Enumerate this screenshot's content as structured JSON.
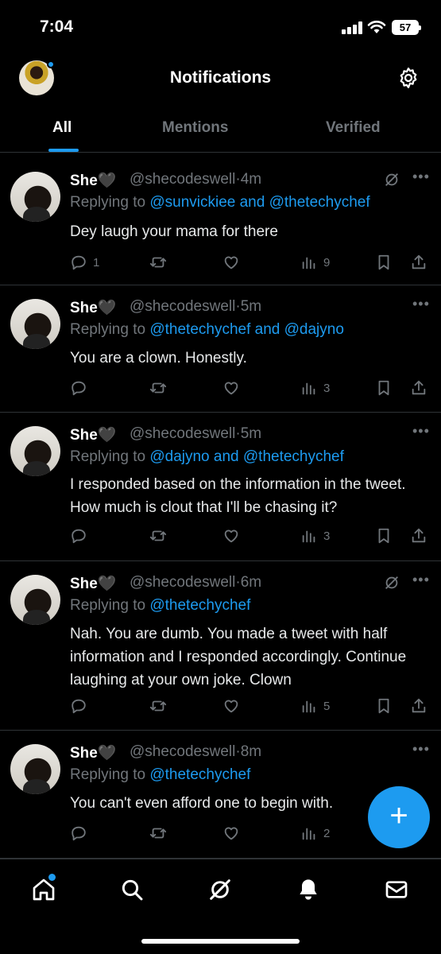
{
  "status_bar": {
    "time": "7:04",
    "battery": "57"
  },
  "header": {
    "title": "Notifications"
  },
  "tabs": [
    {
      "label": "All",
      "active": true
    },
    {
      "label": "Mentions",
      "active": false
    },
    {
      "label": "Verified",
      "active": false
    }
  ],
  "tweets": [
    {
      "name": "She🖤",
      "handle": "@shecodeswell",
      "time": "4m",
      "replying_prefix": "Replying to",
      "mentions": "@sunvickiee and @thetechychef",
      "text": "Dey laugh your mama for there",
      "replies": "1",
      "views": "9",
      "grok": true
    },
    {
      "name": "She🖤",
      "handle": "@shecodeswell",
      "time": "5m",
      "replying_prefix": "Replying to",
      "mentions": "@thetechychef and @dajyno",
      "text": "You are a clown. Honestly.",
      "replies": "",
      "views": "3",
      "grok": false
    },
    {
      "name": "She🖤",
      "handle": "@shecodeswell",
      "time": "5m",
      "replying_prefix": "Replying to",
      "mentions": "@dajyno and @thetechychef",
      "text": "I responded based on the information in the tweet. How much is clout that I'll be chasing it?",
      "replies": "",
      "views": "3",
      "grok": false
    },
    {
      "name": "She🖤",
      "handle": "@shecodeswell",
      "time": "6m",
      "replying_prefix": "Replying to",
      "mentions": "@thetechychef",
      "text": "Nah. You are dumb. You made a tweet with half information and I responded accordingly. Continue laughing at your own joke. Clown",
      "replies": "",
      "views": "5",
      "grok": true
    },
    {
      "name": "She🖤",
      "handle": "@shecodeswell",
      "time": "8m",
      "replying_prefix": "Replying to",
      "mentions": "@thetechychef",
      "text": "You can't even afford one to begin with.",
      "replies": "",
      "views": "2",
      "grok": false
    }
  ],
  "fab": {
    "label": "+"
  },
  "icons": {
    "accent": "#1d9bf0",
    "nav": [
      "home-icon",
      "search-icon",
      "grok-icon",
      "notifications-bell-icon",
      "messages-mail-icon"
    ]
  }
}
